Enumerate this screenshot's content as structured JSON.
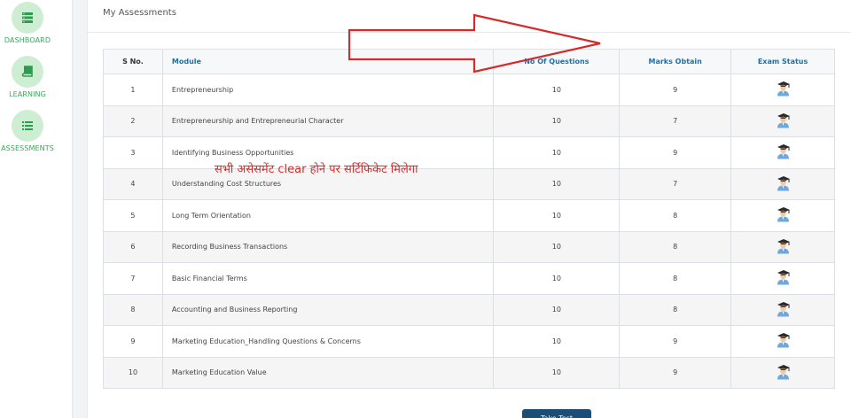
{
  "sidebar": {
    "items": [
      {
        "label": "DASHBOARD",
        "icon": "dashboard-icon"
      },
      {
        "label": "LEARNING",
        "icon": "book-icon"
      },
      {
        "label": "ASSESSMENTS",
        "icon": "list-icon"
      }
    ]
  },
  "panel": {
    "title": "My Assessments"
  },
  "table": {
    "headers": {
      "sno": "S No.",
      "module": "Module",
      "questions": "No Of Questions",
      "marks": "Marks Obtain",
      "status": "Exam Status"
    },
    "rows": [
      {
        "sno": "1",
        "module": "Entrepreneurship",
        "questions": "10",
        "marks": "9",
        "status_icon": "student-graduate-icon"
      },
      {
        "sno": "2",
        "module": "Entrepreneurship and Entrepreneurial Character",
        "questions": "10",
        "marks": "7",
        "status_icon": "student-graduate-icon"
      },
      {
        "sno": "3",
        "module": "Identifying Business Opportunities",
        "questions": "10",
        "marks": "9",
        "status_icon": "student-graduate-icon"
      },
      {
        "sno": "4",
        "module": "Understanding Cost Structures",
        "questions": "10",
        "marks": "7",
        "status_icon": "student-graduate-icon"
      },
      {
        "sno": "5",
        "module": "Long Term Orientation",
        "questions": "10",
        "marks": "8",
        "status_icon": "student-graduate-icon"
      },
      {
        "sno": "6",
        "module": "Recording Business Transactions",
        "questions": "10",
        "marks": "8",
        "status_icon": "student-graduate-icon"
      },
      {
        "sno": "7",
        "module": "Basic Financial Terms",
        "questions": "10",
        "marks": "8",
        "status_icon": "student-graduate-icon"
      },
      {
        "sno": "8",
        "module": "Accounting and Business Reporting",
        "questions": "10",
        "marks": "8",
        "status_icon": "student-graduate-icon"
      },
      {
        "sno": "9",
        "module": "Marketing Education_Handling Questions & Concerns",
        "questions": "10",
        "marks": "9",
        "status_icon": "student-graduate-icon"
      },
      {
        "sno": "10",
        "module": "Marketing Education Value",
        "questions": "10",
        "marks": "9",
        "status_icon": "student-graduate-icon"
      }
    ]
  },
  "annotation": {
    "text": "सभी असेसमेंट clear होने पर सर्टिफिकेट मिलेगा",
    "color": "#d42a2a"
  },
  "arrow": {
    "color": "#d42a2a"
  },
  "submit_button": {
    "label": "Take Test"
  },
  "colors": {
    "accent": "#3aa85a",
    "header_text": "#1f6fa8",
    "button": "#1c4d75"
  }
}
